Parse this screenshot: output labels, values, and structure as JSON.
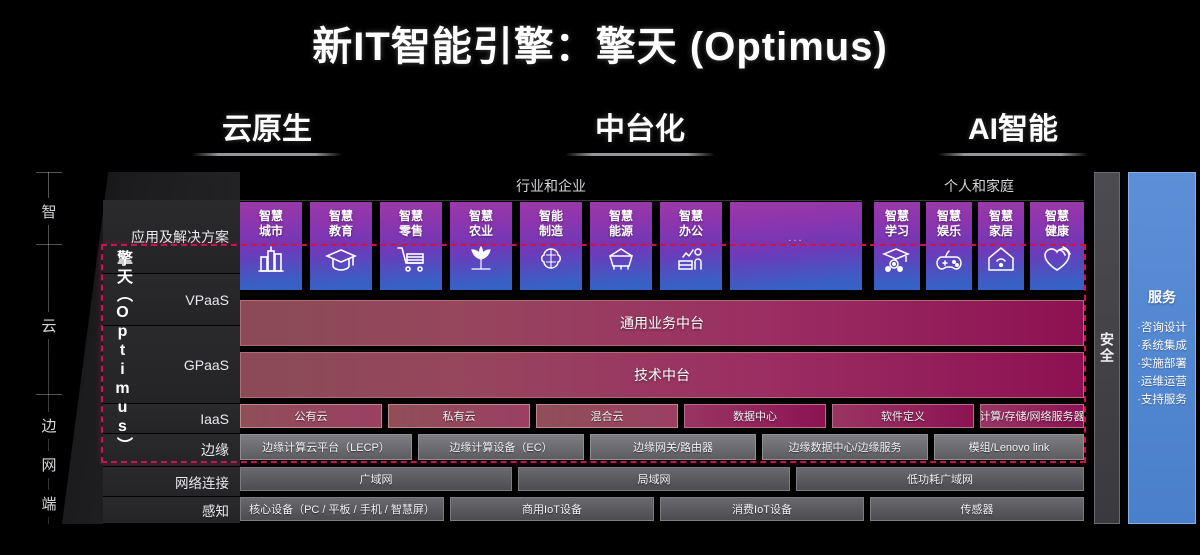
{
  "title": "新IT智能引擎：擎天 (Optimus)",
  "pillars": [
    {
      "label": "云原生"
    },
    {
      "label": "中台化"
    },
    {
      "label": "AI智能"
    }
  ],
  "axis": {
    "labels": [
      "智",
      "云",
      "边",
      "网",
      "端"
    ]
  },
  "optimus": {
    "vertical_label": "擎天（Optimus）"
  },
  "row_labels": [
    {
      "label": "应用及解决方案"
    },
    {
      "label": "VPaaS"
    },
    {
      "label": "GPaaS"
    },
    {
      "label": "IaaS"
    },
    {
      "label": "边缘"
    },
    {
      "label": "网络连接"
    },
    {
      "label": "感知"
    }
  ],
  "sections": [
    {
      "label": "行业和企业"
    },
    {
      "label": "个人和家庭"
    }
  ],
  "apps": [
    {
      "text": "智慧\n城市",
      "line1": "智慧",
      "line2": "城市",
      "icon": "city-icon"
    },
    {
      "text": "智慧教育",
      "line1": "智慧",
      "line2": "教育",
      "icon": "graduation-cap-icon"
    },
    {
      "text": "智慧零售",
      "line1": "智慧",
      "line2": "零售",
      "icon": "shopping-cart-icon"
    },
    {
      "text": "智慧农业",
      "line1": "智慧",
      "line2": "农业",
      "icon": "plant-icon"
    },
    {
      "text": "智能制造",
      "line1": "智能",
      "line2": "制造",
      "icon": "gear-brain-icon"
    },
    {
      "text": "智慧能源",
      "line1": "智慧",
      "line2": "能源",
      "icon": "energy-icon"
    },
    {
      "text": "智慧办公",
      "line1": "智慧",
      "line2": "办公",
      "icon": "office-icon"
    },
    {
      "text": "...",
      "line1": "...",
      "line2": "",
      "icon": "ellipsis-icon"
    },
    {
      "text": "智慧学习",
      "line1": "智慧",
      "line2": "学习",
      "icon": "learning-icon"
    },
    {
      "text": "智慧娱乐",
      "line1": "智慧",
      "line2": "娱乐",
      "icon": "gamepad-icon"
    },
    {
      "text": "智慧家居",
      "line1": "智慧",
      "line2": "家居",
      "icon": "home-icon"
    },
    {
      "text": "智慧健康",
      "line1": "智慧",
      "line2": "健康",
      "icon": "heart-pulse-icon"
    }
  ],
  "platform_bars": [
    {
      "label": "通用业务中台"
    },
    {
      "label": "技术中台"
    }
  ],
  "iaas_items": [
    {
      "label": "公有云"
    },
    {
      "label": "私有云"
    },
    {
      "label": "混合云"
    },
    {
      "label": "数据中心"
    },
    {
      "label": "软件定义"
    },
    {
      "label": "计算/存储/网络服务器"
    }
  ],
  "edge_items": [
    {
      "label": "边缘计算云平台（LECP）"
    },
    {
      "label": "边缘计算设备（EC）"
    },
    {
      "label": "边缘网关/路由器"
    },
    {
      "label": "边缘数据中心/边缘服务"
    },
    {
      "label": "模组/Lenovo link"
    }
  ],
  "network_items": [
    {
      "label": "广域网"
    },
    {
      "label": "局域网"
    },
    {
      "label": "低功耗广域网"
    }
  ],
  "sense_items": [
    {
      "label": "核心设备（PC / 平板 / 手机 / 智慧屏）"
    },
    {
      "label": "商用IoT设备"
    },
    {
      "label": "消费IoT设备"
    },
    {
      "label": "传感器"
    }
  ],
  "security_column": {
    "label": "安全"
  },
  "service_column": {
    "title": "服务",
    "items": [
      {
        "label": "·咨询设计"
      },
      {
        "label": "·系统集成"
      },
      {
        "label": "·实施部署"
      },
      {
        "label": "·运维运营"
      },
      {
        "label": "·支持服务"
      }
    ]
  },
  "colors": {
    "background": "#000000",
    "accent_magenta": "#8d1152",
    "accent_purple": "#9a3aa8",
    "accent_blue": "#3463c6",
    "service_blue": "#5388d2",
    "dashed_box": "#c4174f"
  }
}
